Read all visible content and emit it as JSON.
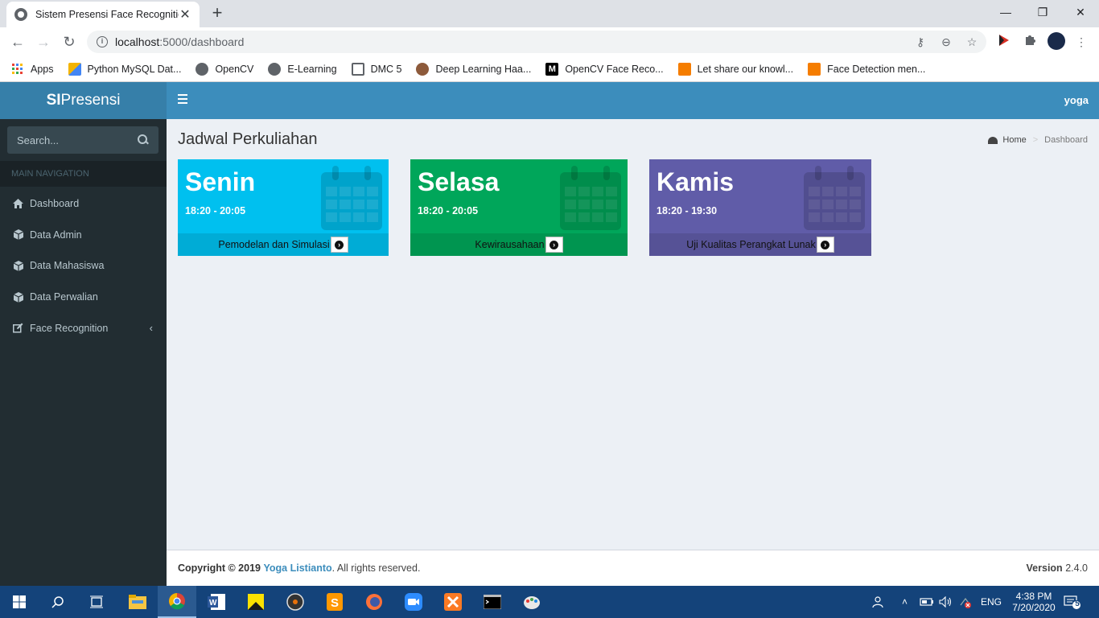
{
  "browser": {
    "tab_title": "Sistem Presensi Face Recognition",
    "url_host": "localhost",
    "url_path": ":5000/dashboard",
    "bookmarks": [
      {
        "label": "Apps",
        "icon": "apps-grid-icon"
      },
      {
        "label": "Python MySQL Dat...",
        "icon": "bookmark-favicon"
      },
      {
        "label": "OpenCV",
        "icon": "globe-icon"
      },
      {
        "label": "E-Learning",
        "icon": "globe-icon"
      },
      {
        "label": "DMC 5",
        "icon": "chip-icon"
      },
      {
        "label": "Deep Learning Haa...",
        "icon": "person-favicon"
      },
      {
        "label": "OpenCV Face Reco...",
        "icon": "medium-icon"
      },
      {
        "label": "Let share our knowl...",
        "icon": "blogger-icon"
      },
      {
        "label": "Face Detection men...",
        "icon": "blogger-icon"
      }
    ]
  },
  "app": {
    "logo_bold": "SI",
    "logo_rest": "Presensi",
    "user": "yoga"
  },
  "sidebar": {
    "search_placeholder": "Search...",
    "nav_header": "MAIN NAVIGATION",
    "items": [
      {
        "label": "Dashboard",
        "icon": "home-icon"
      },
      {
        "label": "Data Admin",
        "icon": "cube-icon"
      },
      {
        "label": "Data Mahasiswa",
        "icon": "cube-icon"
      },
      {
        "label": "Data Perwalian",
        "icon": "cube-icon"
      },
      {
        "label": "Face Recognition",
        "icon": "edit-icon"
      }
    ]
  },
  "content": {
    "title": "Jadwal Perkuliahan",
    "breadcrumb": {
      "home": "Home",
      "current": "Dashboard"
    },
    "boxes": [
      {
        "day": "Senin",
        "time": "18:20 - 20:05",
        "course": "Pemodelan dan Simulasi",
        "color": "#00c0ef"
      },
      {
        "day": "Selasa",
        "time": "18:20 - 20:05",
        "course": "Kewirausahaan",
        "color": "#00a65a"
      },
      {
        "day": "Kamis",
        "time": "18:20 - 19:30",
        "course": "Uji Kualitas Perangkat Lunak",
        "color": "#605ca8"
      }
    ]
  },
  "footer": {
    "copyright_prefix": "Copyright © 2019",
    "author": "Yoga Listianto",
    "suffix": ". All rights reserved.",
    "version_label": "Version",
    "version_number": "2.4.0"
  },
  "taskbar": {
    "language": "ENG",
    "time": "4:38 PM",
    "date": "7/20/2020",
    "notifications": "5"
  }
}
